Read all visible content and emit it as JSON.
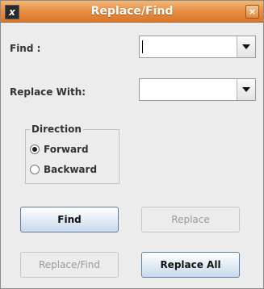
{
  "window": {
    "title": "Replace/Find",
    "app_icon": "app-logo-icon",
    "close_icon": "close-icon",
    "close_glyph": "×"
  },
  "find": {
    "label": "Find :",
    "value": ""
  },
  "replace": {
    "label": "Replace With:",
    "value": ""
  },
  "direction": {
    "legend": "Direction",
    "options": [
      {
        "label": "Forward",
        "checked": true
      },
      {
        "label": "Backward",
        "checked": false
      }
    ]
  },
  "buttons": {
    "find": "Find",
    "replace": "Replace",
    "replace_find": "Replace/Find",
    "replace_all": "Replace All"
  },
  "colors": {
    "titlebar": "#e89046",
    "primary_button_border": "#5b7fa6",
    "disabled_text": "#9a9a9a"
  }
}
